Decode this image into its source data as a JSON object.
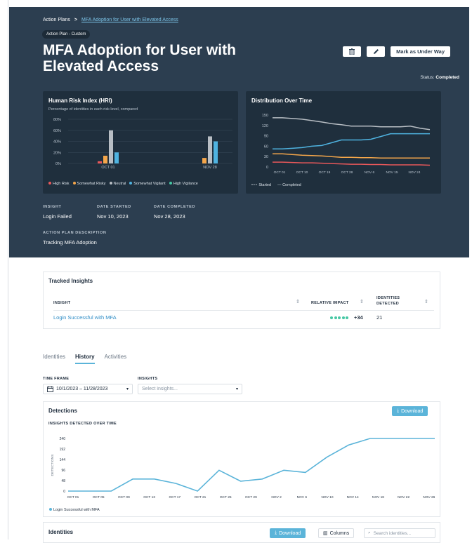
{
  "breadcrumb": {
    "root": "Action Plans",
    "separator": ">",
    "current": "MFA Adoption for User with Elevated Access"
  },
  "plan_tag": "Action Plan - Custom",
  "title": "MFA Adoption for User with Elevated Access",
  "actions": {
    "delete_icon": "trash-icon",
    "edit_icon": "pencil-icon",
    "mark_label": "Mark as Under Way"
  },
  "status": {
    "label": "Status:",
    "value": "Completed"
  },
  "hri": {
    "title": "Human Risk Index (HRI)",
    "subtitle": "Percentage of identities in each risk level, compared",
    "legend": [
      {
        "label": "High Risk",
        "color": "#e8585a"
      },
      {
        "label": "Somewhat Risky",
        "color": "#f4a64a"
      },
      {
        "label": "Neutral",
        "color": "#b8bec4"
      },
      {
        "label": "Somewhat Vigilant",
        "color": "#4fb3e0"
      },
      {
        "label": "High Vigilance",
        "color": "#46c7a4"
      }
    ]
  },
  "distribution": {
    "title": "Distribution Over Time",
    "legend": [
      {
        "label": "Started",
        "style": "dotted"
      },
      {
        "label": "Completed",
        "style": "solid"
      }
    ]
  },
  "meta": {
    "insight_label": "INSIGHT",
    "insight_value": "Login Failed",
    "started_label": "DATE STARTED",
    "started_value": "Nov 10, 2023",
    "completed_label": "DATE COMPLETED",
    "completed_value": "Nov 28, 2023",
    "desc_label": "ACTION PLAN DESCRIPTION",
    "desc_value": "Tracking MFA Adoption"
  },
  "tracked": {
    "title": "Tracked Insights",
    "columns": {
      "insight": "INSIGHT",
      "impact": "RELATIVE IMPACT",
      "identities_1": "IDENTITIES",
      "identities_2": "DETECTED"
    },
    "rows": [
      {
        "insight": "Login Successful with MFA",
        "impact_value": "+34",
        "impact_dots": 5,
        "identities": "21"
      }
    ]
  },
  "tabs": [
    {
      "label": "Identities",
      "active": false
    },
    {
      "label": "History",
      "active": true
    },
    {
      "label": "Activities",
      "active": false
    }
  ],
  "filters": {
    "timeframe_label": "TIME FRAME",
    "timeframe_value": "10/1/2023 – 11/28/2023",
    "insights_label": "INSIGHTS",
    "insights_placeholder": "Select insights..."
  },
  "detections": {
    "title": "Detections",
    "download_label": "Download"
  },
  "identities_panel": {
    "title": "Identities",
    "download_label": "Download",
    "columns_label": "Columns",
    "search_placeholder": "Search identities..."
  },
  "chart_data": [
    {
      "type": "bar",
      "title": "Human Risk Index (HRI)",
      "subtitle": "Percentage of identities in each risk level, compared",
      "categories": [
        "OCT 01",
        "NOV 28"
      ],
      "ylim": [
        0,
        80
      ],
      "yticks": [
        "0%",
        "20%",
        "40%",
        "60%",
        "80%"
      ],
      "series": [
        {
          "name": "High Risk",
          "color": "#e8585a",
          "values": [
            4,
            0
          ]
        },
        {
          "name": "Somewhat Risky",
          "color": "#f4a64a",
          "values": [
            14,
            10
          ]
        },
        {
          "name": "Neutral",
          "color": "#b8bec4",
          "values": [
            60,
            49
          ]
        },
        {
          "name": "Somewhat Vigilant",
          "color": "#4fb3e0",
          "values": [
            20,
            40
          ]
        },
        {
          "name": "High Vigilance",
          "color": "#46c7a4",
          "values": [
            0,
            0
          ]
        }
      ]
    },
    {
      "type": "line",
      "title": "Distribution Over Time",
      "x": [
        "OCT 01",
        "OCT 10",
        "OCT 19",
        "OCT 28",
        "NOV 6",
        "NOV 15",
        "NOV 24"
      ],
      "ylim": [
        0,
        150
      ],
      "yticks": [
        "0",
        "30",
        "60",
        "90",
        "120",
        "150"
      ],
      "series": [
        {
          "color": "#b8bec4",
          "values": [
            142,
            142,
            140,
            138,
            134,
            130,
            125,
            122,
            118,
            118,
            118,
            116,
            116,
            116,
            118,
            112,
            108
          ]
        },
        {
          "color": "#4fb3e0",
          "values": [
            52,
            52,
            54,
            56,
            60,
            62,
            70,
            78,
            78,
            78,
            80,
            88,
            96,
            96,
            96,
            96,
            96
          ]
        },
        {
          "color": "#f4a64a",
          "values": [
            38,
            38,
            36,
            34,
            33,
            32,
            30,
            28,
            28,
            27,
            27,
            26,
            26,
            26,
            26,
            26,
            26
          ]
        },
        {
          "color": "#e8585a",
          "values": [
            14,
            14,
            13,
            12,
            12,
            11,
            10,
            9,
            8,
            8,
            7,
            7,
            6,
            6,
            6,
            6,
            5
          ]
        }
      ],
      "legend": [
        "Started",
        "Completed"
      ]
    },
    {
      "type": "line",
      "title": "INSIGHTS DETECTED OVER TIME",
      "ylabel": "DETECTIONS",
      "x": [
        "OCT 01",
        "OCT 05",
        "OCT 09",
        "OCT 13",
        "OCT 17",
        "OCT 21",
        "OCT 25",
        "OCT 29",
        "NOV 2",
        "NOV 6",
        "NOV 10",
        "NOV 14",
        "NOV 18",
        "NOV 22",
        "NOV 26"
      ],
      "ylim": [
        0,
        240
      ],
      "yticks": [
        "0",
        "48",
        "96",
        "144",
        "192",
        "240"
      ],
      "series": [
        {
          "name": "Login Successful with MFA",
          "color": "#5bb4d9",
          "values": [
            0,
            0,
            0,
            55,
            55,
            35,
            0,
            95,
            45,
            55,
            95,
            85,
            155,
            210,
            240,
            240,
            240,
            240
          ]
        }
      ]
    }
  ]
}
